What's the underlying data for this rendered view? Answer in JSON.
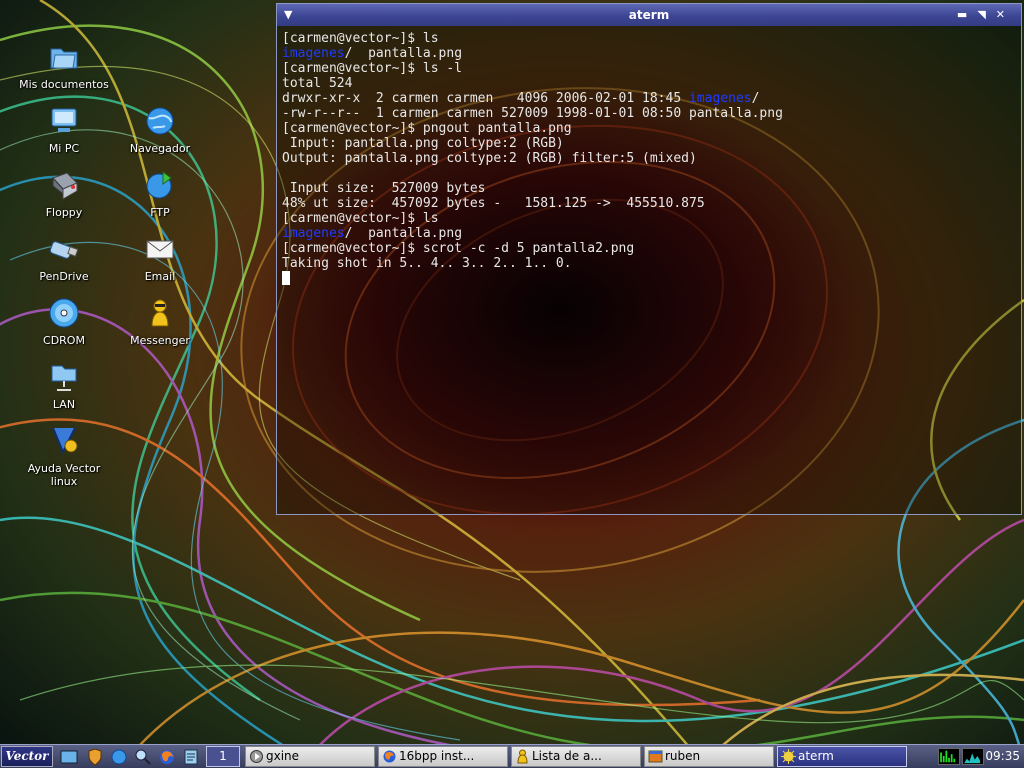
{
  "desktop": {
    "icons": [
      {
        "label": "Mis documentos",
        "icon": "documents-folder-icon"
      },
      {
        "label": "Mi PC",
        "icon": "computer-icon"
      },
      {
        "label": "Navegador",
        "icon": "browser-globe-icon"
      },
      {
        "label": "Floppy",
        "icon": "floppy-drive-icon"
      },
      {
        "label": "FTP",
        "icon": "ftp-globe-icon"
      },
      {
        "label": "PenDrive",
        "icon": "usb-pendrive-icon"
      },
      {
        "label": "Email",
        "icon": "email-envelope-icon"
      },
      {
        "label": "CDROM",
        "icon": "cdrom-disc-icon"
      },
      {
        "label": "Messenger",
        "icon": "messenger-person-icon"
      },
      {
        "label": "LAN",
        "icon": "lan-network-icon"
      },
      {
        "label": "Ayuda Vector linux",
        "icon": "help-vector-icon"
      }
    ]
  },
  "terminal": {
    "title": "aterm",
    "menu_glyph": "▼",
    "controls": [
      "▬",
      "◥",
      "✕"
    ],
    "lines": [
      [
        {
          "t": "[carmen@vector~]$ ls"
        }
      ],
      [
        {
          "t": "imagenes",
          "c": "dir"
        },
        {
          "t": "/  pantalla.png"
        }
      ],
      [
        {
          "t": "[carmen@vector~]$ ls -l"
        }
      ],
      [
        {
          "t": "total 524"
        }
      ],
      [
        {
          "t": "drwxr-xr-x  2 carmen carmen   4096 2006-02-01 18:45 "
        },
        {
          "t": "imagenes",
          "c": "dir"
        },
        {
          "t": "/"
        }
      ],
      [
        {
          "t": "-rw-r--r--  1 carmen carmen 527009 1998-01-01 08:50 pantalla.png"
        }
      ],
      [
        {
          "t": "[carmen@vector~]$ pngout pantalla.png"
        }
      ],
      [
        {
          "t": " Input: pantalla.png coltype:2 (RGB)"
        }
      ],
      [
        {
          "t": "Output: pantalla.png coltype:2 (RGB) filter:5 (mixed)"
        }
      ],
      [
        {
          "t": ""
        }
      ],
      [
        {
          "t": " Input size:  527009 bytes"
        }
      ],
      [
        {
          "t": "48% ut size:  457092 bytes -   1581.125 ->  455510.875"
        }
      ],
      [
        {
          "t": "[carmen@vector~]$ ls"
        }
      ],
      [
        {
          "t": "imagenes",
          "c": "dir"
        },
        {
          "t": "/  pantalla.png"
        }
      ],
      [
        {
          "t": "[carmen@vector~]$ scrot -c -d 5 pantalla2.png"
        }
      ],
      [
        {
          "t": "Taking shot in 5.. 4.. 3.. 2.. 1.. 0."
        }
      ]
    ],
    "dir_color": "#1f3bff"
  },
  "taskbar": {
    "start_label": "Vector",
    "quick_launch": [
      {
        "icon": "terminal-launch-icon"
      },
      {
        "icon": "shield-launch-icon"
      },
      {
        "icon": "browser-launch-icon"
      },
      {
        "icon": "search-launch-icon"
      },
      {
        "icon": "firefox-launch-icon"
      },
      {
        "icon": "files-launch-icon"
      }
    ],
    "pager": "1",
    "tasks": [
      {
        "label": "gxine",
        "icon": "gxine-icon",
        "active": false
      },
      {
        "label": "16bpp inst...",
        "icon": "firefox-icon",
        "active": false
      },
      {
        "label": "Lista de a...",
        "icon": "messenger-icon",
        "active": false
      },
      {
        "label": "ruben",
        "icon": "window-icon",
        "active": false
      },
      {
        "label": "aterm",
        "icon": "aterm-icon",
        "active": true
      }
    ],
    "clock": "09:35"
  },
  "colors": {
    "titlebar": "#3d4693",
    "taskbar": "#4a5077",
    "active_task": "#2a3280"
  }
}
